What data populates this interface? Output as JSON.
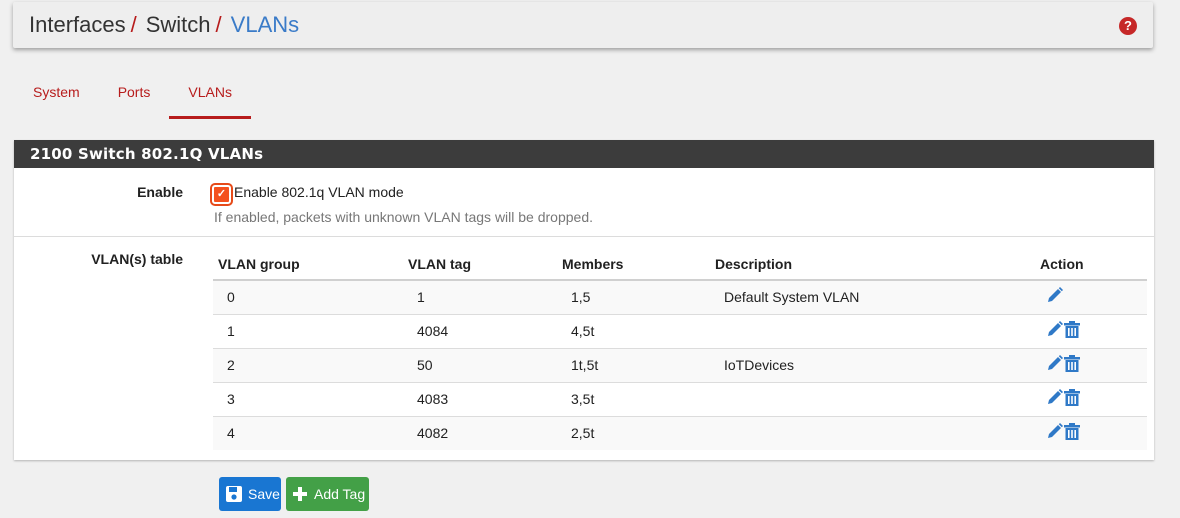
{
  "breadcrumb": {
    "items": [
      "Interfaces",
      "Switch"
    ],
    "separator": "/",
    "active": "VLANs"
  },
  "tabs": [
    {
      "label": "System"
    },
    {
      "label": "Ports"
    },
    {
      "label": "VLANs",
      "active": true
    }
  ],
  "panel": {
    "title": "2100 Switch 802.1Q VLANs",
    "enable": {
      "label": "Enable",
      "checkbox_label": "Enable 802.1q VLAN mode",
      "checked": true,
      "help": "If enabled, packets with unknown VLAN tags will be dropped."
    },
    "table": {
      "label": "VLAN(s) table",
      "columns": [
        "VLAN group",
        "VLAN tag",
        "Members",
        "Description",
        "Action"
      ],
      "rows": [
        {
          "group": "0",
          "tag": "1",
          "members": "1,5",
          "description": "Default System VLAN",
          "actions": [
            "edit-icon"
          ]
        },
        {
          "group": "1",
          "tag": "4084",
          "members": "4,5t",
          "description": "",
          "actions": [
            "edit-icon",
            "trash-icon"
          ]
        },
        {
          "group": "2",
          "tag": "50",
          "members": "1t,5t",
          "description": "IoTDevices",
          "actions": [
            "edit-icon",
            "trash-icon"
          ]
        },
        {
          "group": "3",
          "tag": "4083",
          "members": "3,5t",
          "description": "",
          "actions": [
            "edit-icon",
            "trash-icon"
          ]
        },
        {
          "group": "4",
          "tag": "4082",
          "members": "2,5t",
          "description": "",
          "actions": [
            "edit-icon",
            "trash-icon"
          ]
        }
      ]
    }
  },
  "buttons": {
    "save": "Save",
    "add_tag": "Add Tag"
  },
  "colors": {
    "accent_red": "#b71c1c",
    "link_blue": "#3a7bc8",
    "save_blue": "#1976d2",
    "add_green": "#43a047",
    "header_dark": "#3c3c3c"
  }
}
